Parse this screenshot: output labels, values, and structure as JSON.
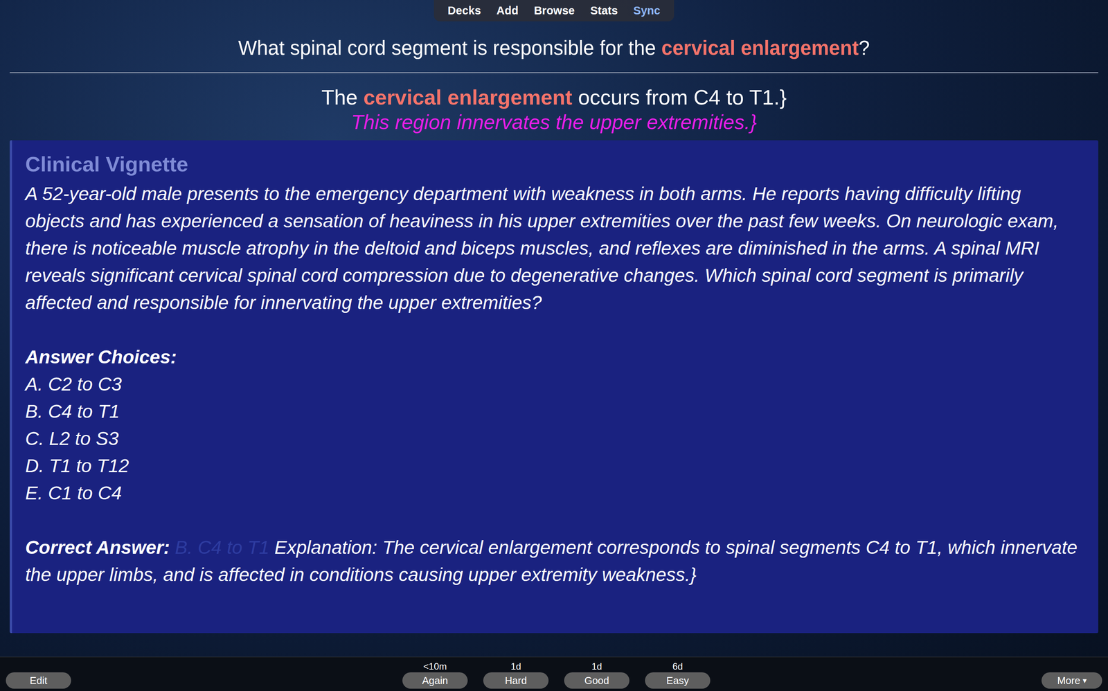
{
  "nav": [
    {
      "label": "Decks",
      "selected": false
    },
    {
      "label": "Add",
      "selected": false
    },
    {
      "label": "Browse",
      "selected": false
    },
    {
      "label": "Stats",
      "selected": false
    },
    {
      "label": "Sync",
      "selected": true
    }
  ],
  "question": {
    "before": "What spinal cord segment is responsible for the ",
    "highlight": "cervical enlargement",
    "after": "?"
  },
  "answer": {
    "before": "The ",
    "highlight": "cervical enlargement",
    "after": " occurs from C4 to T1.}",
    "note": "This region innervates the upper extremities.}"
  },
  "vignette": {
    "title": "Clinical Vignette",
    "text": "A 52-year-old male presents to the emergency department with weakness in both arms. He reports having difficulty lifting objects and has experienced a sensation of heaviness in his upper extremities over the past few weeks. On neurologic exam, there is noticeable muscle atrophy in the deltoid and biceps muscles, and reflexes are diminished in the arms. A spinal MRI reveals significant cervical spinal cord compression due to degenerative changes. Which spinal cord segment is primarily affected and responsible for innervating the upper extremities?",
    "choices_label": "Answer Choices:",
    "choices": [
      "A. C2 to C3",
      "B. C4 to T1",
      "C. L2 to S3",
      "D. T1 to T12",
      "E. C1 to C4"
    ],
    "correct_label": "Correct Answer:",
    "correct_answer": "B. C4 to T1",
    "explanation": "Explanation: The cervical enlargement corresponds to spinal segments C4 to T1, which innervate the upper limbs, and is affected in conditions causing upper extremity weakness.}"
  },
  "toolbar": {
    "edit": "Edit",
    "more": "More",
    "more_icon": "▾",
    "answers": [
      {
        "label": "Again",
        "interval": "<10m"
      },
      {
        "label": "Hard",
        "interval": "1d"
      },
      {
        "label": "Good",
        "interval": "1d"
      },
      {
        "label": "Easy",
        "interval": "6d"
      }
    ]
  }
}
